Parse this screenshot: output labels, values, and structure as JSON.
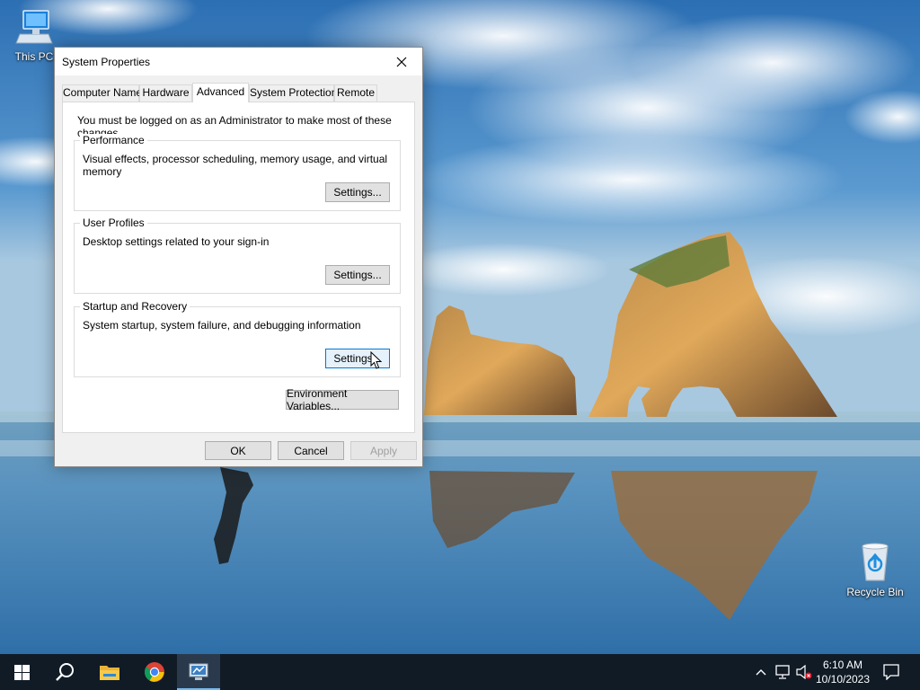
{
  "desktop": {
    "icons": [
      {
        "label": "This PC",
        "icon": "computer-icon"
      },
      {
        "label": "Recycle Bin",
        "icon": "recycle-bin-icon"
      }
    ]
  },
  "dialog": {
    "title": "System Properties",
    "tabs": [
      {
        "label": "Computer Name",
        "active": false
      },
      {
        "label": "Hardware",
        "active": false
      },
      {
        "label": "Advanced",
        "active": true
      },
      {
        "label": "System Protection",
        "active": false
      },
      {
        "label": "Remote",
        "active": false
      }
    ],
    "admin_note": "You must be logged on as an Administrator to make most of these changes.",
    "groups": [
      {
        "title": "Performance",
        "description": "Visual effects, processor scheduling, memory usage, and virtual memory",
        "button": "Settings..."
      },
      {
        "title": "User Profiles",
        "description": "Desktop settings related to your sign-in",
        "button": "Settings..."
      },
      {
        "title": "Startup and Recovery",
        "description": "System startup, system failure, and debugging information",
        "button": "Settings..."
      }
    ],
    "env_button": "Environment Variables...",
    "footer": {
      "ok": "OK",
      "cancel": "Cancel",
      "apply": "Apply"
    }
  },
  "taskbar": {
    "items": [
      "start-icon",
      "search-icon",
      "file-explorer-icon",
      "chrome-icon",
      "system-properties-icon"
    ],
    "active_item": "system-properties-icon",
    "tray": [
      "chevron-up-icon",
      "network-icon",
      "volume-muted-icon"
    ],
    "clock": {
      "time": "6:10 AM",
      "date": "10/10/2023"
    },
    "notification_icon": "action-center-icon"
  },
  "colors": {
    "accent": "#0078d7",
    "taskbar": "#101b26",
    "focused_button": "#e5f1fb"
  }
}
